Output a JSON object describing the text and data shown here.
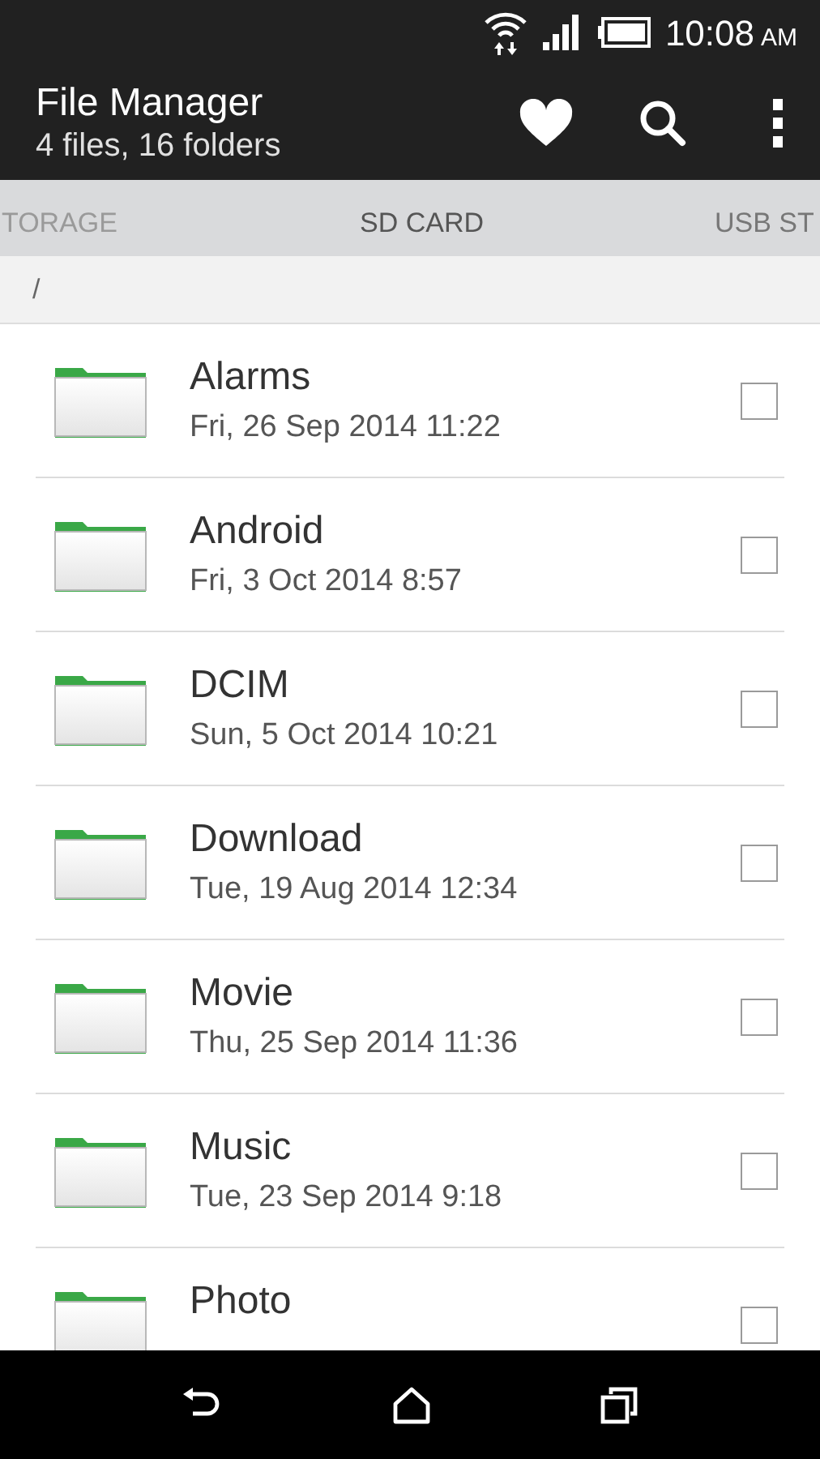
{
  "status_bar": {
    "time": "10:08",
    "meridiem": "AM"
  },
  "app_bar": {
    "title": "File Manager",
    "subtitle": "4 files, 16 folders"
  },
  "tabs": [
    {
      "label": "TORAGE"
    },
    {
      "label": "SD CARD"
    },
    {
      "label": "USB ST"
    }
  ],
  "path": "/",
  "items": [
    {
      "name": "Alarms",
      "date": "Fri, 26 Sep 2014 11:22",
      "checked": false
    },
    {
      "name": "Android",
      "date": "Fri, 3 Oct 2014 8:57",
      "checked": false
    },
    {
      "name": "DCIM",
      "date": "Sun, 5 Oct 2014 10:21",
      "checked": false
    },
    {
      "name": "Download",
      "date": "Tue, 19 Aug 2014 12:34",
      "checked": false
    },
    {
      "name": "Movie",
      "date": "Thu, 25 Sep 2014 11:36",
      "checked": false
    },
    {
      "name": "Music",
      "date": "Tue, 23 Sep 2014 9:18",
      "checked": false
    },
    {
      "name": "Photo",
      "checked": false
    }
  ]
}
